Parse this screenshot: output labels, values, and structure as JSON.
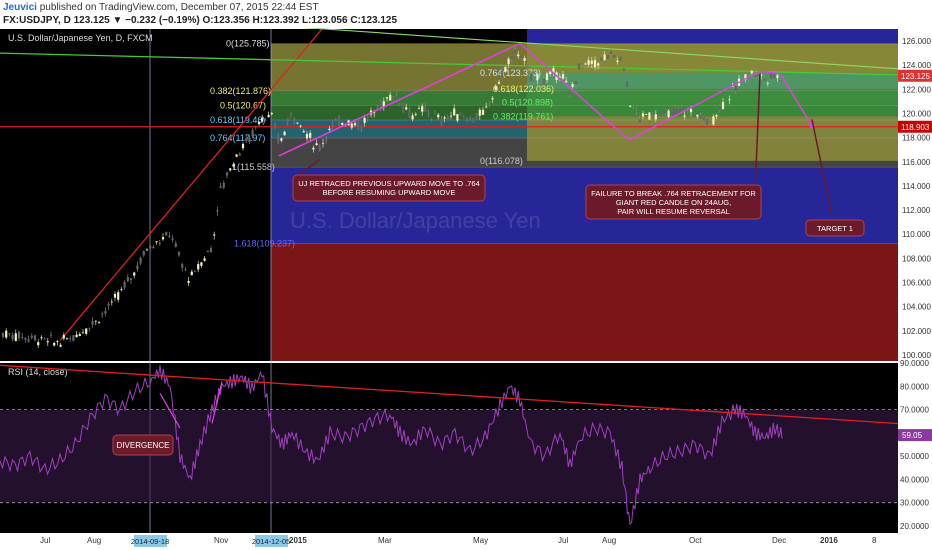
{
  "header": {
    "user": "Jeuvici",
    "published": "published on TradingView.com, December 07, 2015 22:44 EST",
    "quote": "FX:USDJPY, D 123.125 ▼ −0.232 (−0.19%) O:123.356 H:123.392 L:123.056 C:123.125"
  },
  "colors": {
    "bg": "#000000",
    "fib_olive": "#8a8a3a",
    "fib_green": "#3f8f3f",
    "fib_blue": "#2a2aa8",
    "fib_red": "#8a1818",
    "trend_red": "#e02020",
    "trend_green": "#44cc33",
    "path_magenta": "#e040e0",
    "rsi_purple": "#8a3aa0",
    "label_bg": "#6b1a2a"
  },
  "chart_data": [
    {
      "type": "candlestick",
      "title": "U.S. Dollar/Japanese Yen, D, FXCM",
      "watermark": "U.S. Dollar/Japanese Yen",
      "ylim": [
        99.5,
        127.0
      ],
      "y_ticks": [
        "126.000",
        "124.000",
        "122.000",
        "120.000",
        "118.000",
        "116.000",
        "114.000",
        "112.000",
        "110.000",
        "108.000",
        "106.000",
        "104.000",
        "102.000",
        "100.000"
      ],
      "x_labels": [
        "Jul",
        "Aug",
        "Nov",
        "2015",
        "Mar",
        "May",
        "Jul",
        "Aug",
        "Oct",
        "Dec",
        "2016",
        "8"
      ],
      "x_date_marks": [
        "2014-09-18",
        "2014-12-05"
      ],
      "price_markers": [
        {
          "label": "123.125",
          "value": 123.125
        },
        {
          "label": "118.903",
          "value": 118.903
        }
      ],
      "fib_levels": [
        {
          "label": "0(125.785)",
          "value": 125.785
        },
        {
          "label": "0.382(121.876)",
          "value": 121.876
        },
        {
          "label": "0.5(120.67)",
          "value": 120.67
        },
        {
          "label": "0.618(119.46)",
          "value": 119.46
        },
        {
          "label": "0.764(117.97)",
          "value": 117.97
        },
        {
          "label": "1(115.558)",
          "value": 115.558
        },
        {
          "label": "1.618(109.237)",
          "value": 109.237
        }
      ],
      "fib_levels_2": [
        {
          "label": "0.764(123.373)",
          "value": 123.373
        },
        {
          "label": "0.618(122.036)",
          "value": 122.036
        },
        {
          "label": "0.5(120.898)",
          "value": 120.898
        },
        {
          "label": "0.382(119.761)",
          "value": 119.761
        },
        {
          "label": "0(116.078)",
          "value": 116.078
        }
      ],
      "annotations": [
        {
          "text": "UJ RETRACED PREVIOUS UPWARD MOVE TO .764\nBEFORE RESUMING UPWARD MOVE"
        },
        {
          "text": "FAILURE TO BREAK .764 RETRACEMENT FOR\nGIANT RED CANDLE ON 24AUG,\nPAIR WILL RESUME REVERSAL"
        },
        {
          "text": "TARGET 1"
        }
      ],
      "price_path": [
        {
          "x": 0,
          "y": 101.8
        },
        {
          "x": 20,
          "y": 101.6
        },
        {
          "x": 40,
          "y": 101.3
        },
        {
          "x": 60,
          "y": 101.0
        },
        {
          "x": 75,
          "y": 101.6
        },
        {
          "x": 95,
          "y": 102.8
        },
        {
          "x": 115,
          "y": 104.5
        },
        {
          "x": 135,
          "y": 107.0
        },
        {
          "x": 148,
          "y": 109.0
        },
        {
          "x": 160,
          "y": 109.5
        },
        {
          "x": 172,
          "y": 110.0
        },
        {
          "x": 180,
          "y": 107.8
        },
        {
          "x": 190,
          "y": 106.2
        },
        {
          "x": 200,
          "y": 107.5
        },
        {
          "x": 212,
          "y": 109.0
        },
        {
          "x": 220,
          "y": 113.5
        },
        {
          "x": 230,
          "y": 115.5
        },
        {
          "x": 240,
          "y": 117.0
        },
        {
          "x": 250,
          "y": 118.0
        },
        {
          "x": 262,
          "y": 119.8
        },
        {
          "x": 272,
          "y": 119.5
        },
        {
          "x": 280,
          "y": 117.5
        },
        {
          "x": 292,
          "y": 120.2
        },
        {
          "x": 305,
          "y": 118.5
        },
        {
          "x": 318,
          "y": 117.0
        },
        {
          "x": 330,
          "y": 118.8
        },
        {
          "x": 345,
          "y": 119.5
        },
        {
          "x": 360,
          "y": 119.0
        },
        {
          "x": 375,
          "y": 120.2
        },
        {
          "x": 390,
          "y": 121.5
        },
        {
          "x": 400,
          "y": 121.2
        },
        {
          "x": 412,
          "y": 119.8
        },
        {
          "x": 425,
          "y": 120.3
        },
        {
          "x": 440,
          "y": 119.4
        },
        {
          "x": 455,
          "y": 120.0
        },
        {
          "x": 470,
          "y": 119.6
        },
        {
          "x": 485,
          "y": 120.0
        },
        {
          "x": 498,
          "y": 122.5
        },
        {
          "x": 510,
          "y": 124.5
        },
        {
          "x": 520,
          "y": 125.2
        },
        {
          "x": 530,
          "y": 123.0
        },
        {
          "x": 545,
          "y": 122.8
        },
        {
          "x": 560,
          "y": 123.5
        },
        {
          "x": 570,
          "y": 121.5
        },
        {
          "x": 580,
          "y": 124.0
        },
        {
          "x": 595,
          "y": 124.2
        },
        {
          "x": 610,
          "y": 124.8
        },
        {
          "x": 622,
          "y": 124.5
        },
        {
          "x": 630,
          "y": 121.0
        },
        {
          "x": 640,
          "y": 119.5
        },
        {
          "x": 650,
          "y": 120.0
        },
        {
          "x": 665,
          "y": 119.8
        },
        {
          "x": 680,
          "y": 120.2
        },
        {
          "x": 695,
          "y": 120.0
        },
        {
          "x": 710,
          "y": 119.2
        },
        {
          "x": 722,
          "y": 120.8
        },
        {
          "x": 735,
          "y": 122.0
        },
        {
          "x": 745,
          "y": 123.2
        },
        {
          "x": 755,
          "y": 123.3
        },
        {
          "x": 765,
          "y": 122.8
        },
        {
          "x": 775,
          "y": 123.1
        },
        {
          "x": 782,
          "y": 123.125
        }
      ],
      "magenta_path": [
        {
          "x": 279,
          "y": 116.5
        },
        {
          "x": 520,
          "y": 125.8
        },
        {
          "x": 629,
          "y": 117.8
        },
        {
          "x": 760,
          "y": 123.5
        },
        {
          "x": 780,
          "y": 123.3
        },
        {
          "x": 812,
          "y": 119.0
        }
      ]
    },
    {
      "type": "line",
      "title": "RSI (14, close)",
      "ylim": [
        17,
        90
      ],
      "y_ticks": [
        "90.0000",
        "80.0000",
        "70.0000",
        "60.0000",
        "50.0000",
        "40.0000",
        "30.0000",
        "20.0000"
      ],
      "levels": [
        70,
        30
      ],
      "current_value": "59.05",
      "annotation": "DIVERGENCE",
      "rsi_path": [
        {
          "x": 0,
          "y": 48
        },
        {
          "x": 15,
          "y": 46
        },
        {
          "x": 30,
          "y": 50
        },
        {
          "x": 45,
          "y": 44
        },
        {
          "x": 60,
          "y": 48
        },
        {
          "x": 75,
          "y": 55
        },
        {
          "x": 90,
          "y": 66
        },
        {
          "x": 105,
          "y": 75
        },
        {
          "x": 120,
          "y": 70
        },
        {
          "x": 135,
          "y": 78
        },
        {
          "x": 150,
          "y": 82
        },
        {
          "x": 160,
          "y": 87
        },
        {
          "x": 170,
          "y": 80
        },
        {
          "x": 180,
          "y": 50
        },
        {
          "x": 190,
          "y": 40
        },
        {
          "x": 200,
          "y": 55
        },
        {
          "x": 212,
          "y": 70
        },
        {
          "x": 222,
          "y": 80
        },
        {
          "x": 232,
          "y": 82
        },
        {
          "x": 242,
          "y": 84
        },
        {
          "x": 252,
          "y": 79
        },
        {
          "x": 262,
          "y": 86
        },
        {
          "x": 272,
          "y": 62
        },
        {
          "x": 282,
          "y": 55
        },
        {
          "x": 292,
          "y": 60
        },
        {
          "x": 305,
          "y": 52
        },
        {
          "x": 318,
          "y": 48
        },
        {
          "x": 330,
          "y": 60
        },
        {
          "x": 345,
          "y": 58
        },
        {
          "x": 360,
          "y": 62
        },
        {
          "x": 375,
          "y": 66
        },
        {
          "x": 390,
          "y": 68
        },
        {
          "x": 400,
          "y": 60
        },
        {
          "x": 412,
          "y": 55
        },
        {
          "x": 425,
          "y": 62
        },
        {
          "x": 440,
          "y": 55
        },
        {
          "x": 455,
          "y": 60
        },
        {
          "x": 470,
          "y": 52
        },
        {
          "x": 485,
          "y": 58
        },
        {
          "x": 498,
          "y": 70
        },
        {
          "x": 510,
          "y": 80
        },
        {
          "x": 520,
          "y": 74
        },
        {
          "x": 530,
          "y": 56
        },
        {
          "x": 545,
          "y": 50
        },
        {
          "x": 560,
          "y": 60
        },
        {
          "x": 570,
          "y": 46
        },
        {
          "x": 580,
          "y": 58
        },
        {
          "x": 595,
          "y": 62
        },
        {
          "x": 610,
          "y": 60
        },
        {
          "x": 622,
          "y": 45
        },
        {
          "x": 630,
          "y": 20
        },
        {
          "x": 640,
          "y": 40
        },
        {
          "x": 650,
          "y": 45
        },
        {
          "x": 665,
          "y": 50
        },
        {
          "x": 680,
          "y": 52
        },
        {
          "x": 695,
          "y": 55
        },
        {
          "x": 710,
          "y": 50
        },
        {
          "x": 722,
          "y": 65
        },
        {
          "x": 735,
          "y": 70
        },
        {
          "x": 745,
          "y": 68
        },
        {
          "x": 755,
          "y": 60
        },
        {
          "x": 765,
          "y": 58
        },
        {
          "x": 775,
          "y": 62
        },
        {
          "x": 782,
          "y": 59
        }
      ]
    }
  ]
}
